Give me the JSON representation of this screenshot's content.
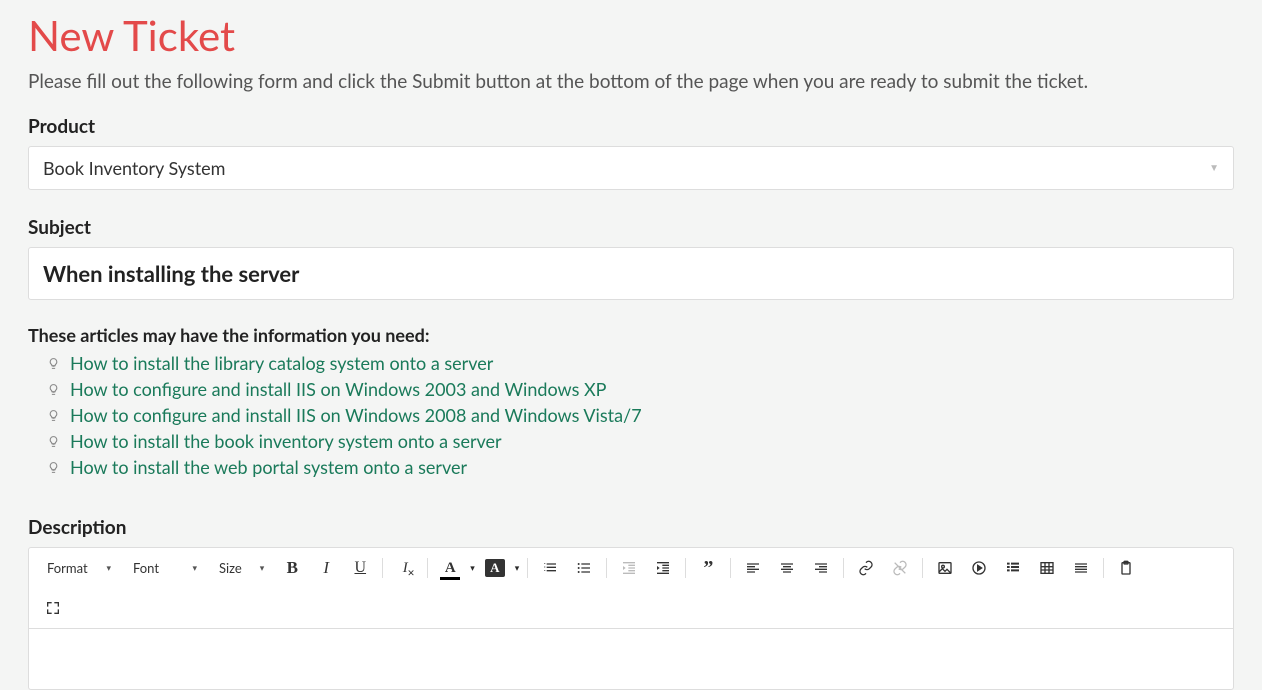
{
  "page": {
    "title": "New Ticket",
    "intro": "Please fill out the following form and click the Submit button at the bottom of the page when you are ready to submit the ticket."
  },
  "product": {
    "label": "Product",
    "selected": "Book Inventory System"
  },
  "subject": {
    "label": "Subject",
    "value": "When installing the server"
  },
  "suggestions": {
    "heading": "These articles may have the information you need:",
    "items": [
      "How to install the library catalog system onto a server",
      "How to configure and install IIS on Windows 2003 and Windows XP",
      "How to configure and install IIS on Windows 2008 and Windows Vista/7",
      "How to install the book inventory system onto a server",
      "How to install the web portal system onto a server"
    ]
  },
  "description": {
    "label": "Description"
  },
  "toolbar": {
    "format": "Format",
    "font": "Font",
    "size": "Size"
  }
}
